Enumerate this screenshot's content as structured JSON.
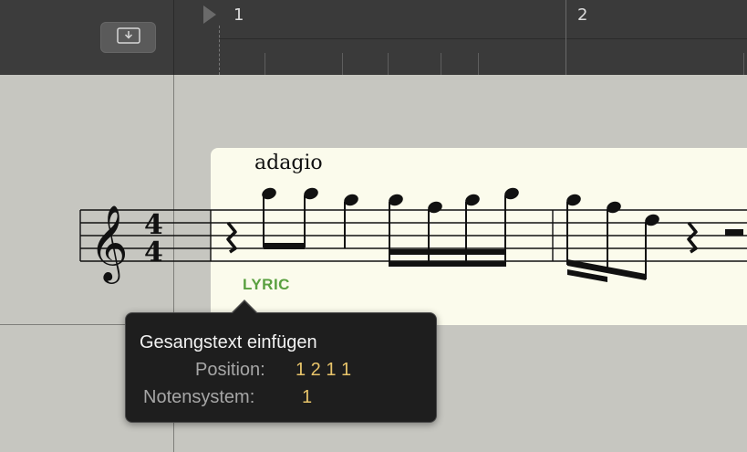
{
  "ruler": {
    "bar_numbers": [
      "1",
      "2"
    ]
  },
  "toolbar": {
    "region_button_icon": "download-tray-icon"
  },
  "score": {
    "tempo_marking": "adagio",
    "time_signature": {
      "numerator": "4",
      "denominator": "4"
    },
    "lyric_label": "LYRIC"
  },
  "tooltip": {
    "title": "Gesangstext einfügen",
    "position_label": "Position:",
    "position_value": "1 2 1 1",
    "staff_label": "Notensystem:",
    "staff_value": "1"
  },
  "colors": {
    "lyric_green": "#5aa040",
    "tooltip_value": "#e8c46a",
    "region_bg": "#fbfbec"
  }
}
